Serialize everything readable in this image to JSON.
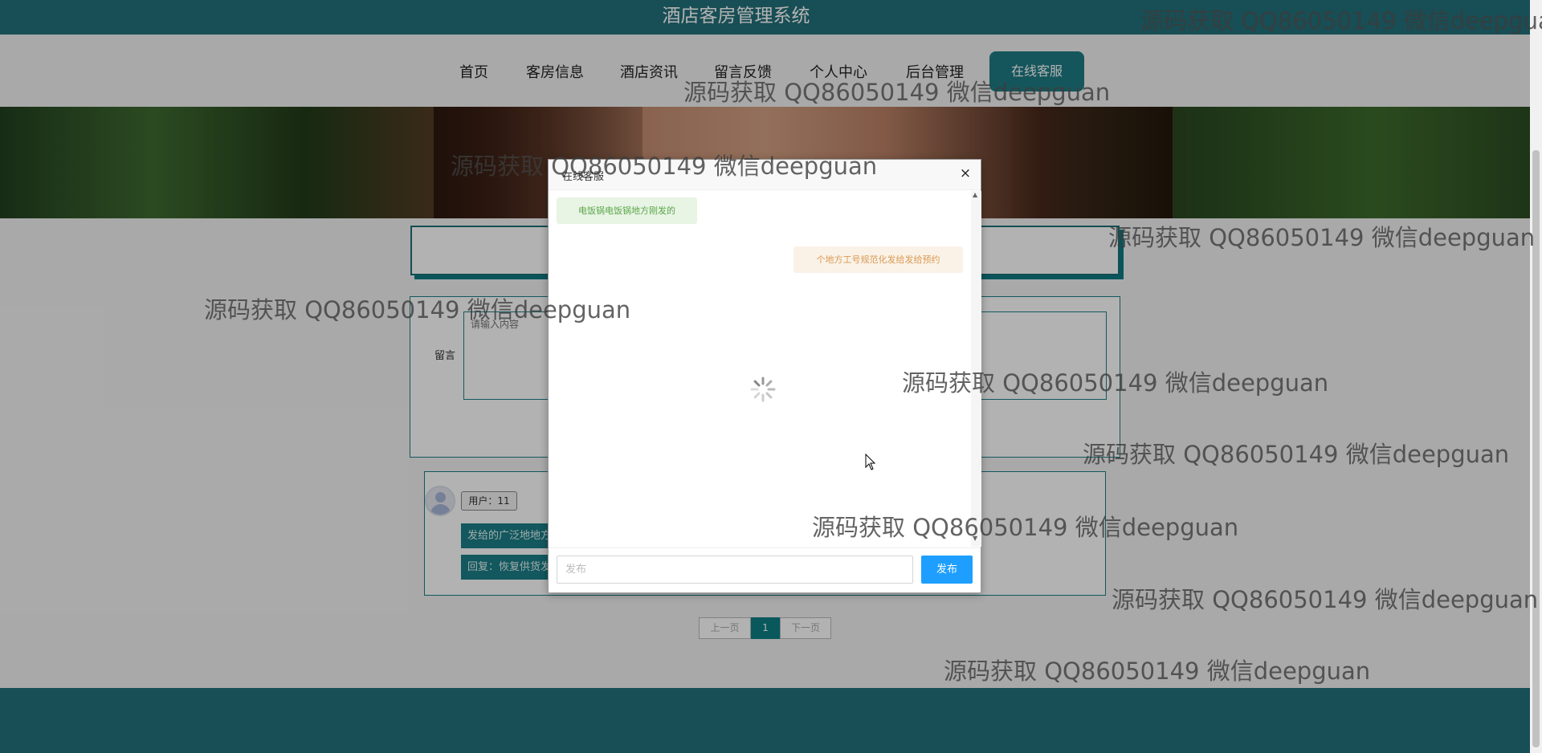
{
  "header": {
    "title": "酒店客房管理系统"
  },
  "nav": {
    "items": [
      "首页",
      "客房信息",
      "酒店资讯",
      "留言反馈",
      "个人中心",
      "后台管理"
    ],
    "service_label": "在线客服"
  },
  "message_form": {
    "label": "留言",
    "placeholder": "请输入内容"
  },
  "comment": {
    "user": "用户：11",
    "content": "发给的广泛地地方",
    "reply": "回复：恢复供货发"
  },
  "pagination": {
    "prev": "上一页",
    "current": "1",
    "next": "下一页"
  },
  "modal": {
    "title": "在线客服",
    "close": "×",
    "messages": [
      {
        "side": "left",
        "text": "电饭锅电饭锅地方刚发的"
      },
      {
        "side": "right",
        "text": "个地方工号规范化发给发给预约"
      }
    ],
    "input_placeholder": "发布",
    "send_label": "发布"
  },
  "watermark": "源码获取 QQ86050149 微信deepguan",
  "colors": {
    "primary": "#23707a",
    "send": "#1e9fff",
    "left_bubble": "#e8f4e4",
    "right_bubble": "#fbf2e7"
  }
}
